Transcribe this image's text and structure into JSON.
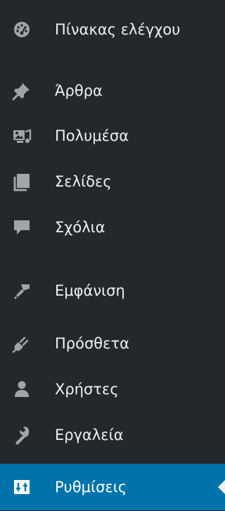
{
  "colors": {
    "background": "#23282d",
    "icon": "#a0a5aa",
    "text": "#f0f0f1",
    "active_background": "#0073aa",
    "active_text": "#ffffff",
    "active_arrow": "#f1f1f1"
  },
  "menu": {
    "items": [
      {
        "label": "Πίνακας ελέγχου",
        "icon": "dashboard-icon"
      },
      {
        "label": "Άρθρα",
        "icon": "pin-icon"
      },
      {
        "label": "Πολυμέσα",
        "icon": "media-icon"
      },
      {
        "label": "Σελίδες",
        "icon": "pages-icon"
      },
      {
        "label": "Σχόλια",
        "icon": "comments-icon"
      },
      {
        "label": "Εμφάνιση",
        "icon": "appearance-icon"
      },
      {
        "label": "Πρόσθετα",
        "icon": "plugins-icon"
      },
      {
        "label": "Χρήστες",
        "icon": "users-icon"
      },
      {
        "label": "Εργαλεία",
        "icon": "tools-icon"
      },
      {
        "label": "Ρυθμίσεις",
        "icon": "settings-icon",
        "active": true
      }
    ]
  }
}
